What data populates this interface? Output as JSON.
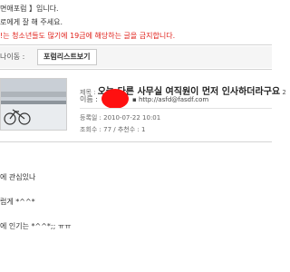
{
  "notice": {
    "line1": "면애포럼 】입니다.",
    "line2": "로에게 잘 해 주세요.",
    "line3": "!는 청소년들도 많기에 19금에 해당하는 글을 금지합니다."
  },
  "nav": {
    "label": "나이동 :",
    "list_button": "포럼리스트보기"
  },
  "post": {
    "title_label": "제목 :",
    "title": "오늘 다른 사무실 여직원이 먼저 인사하더라구요",
    "comment_count": "2",
    "author_label": "이름 :",
    "homepage": "http://asfd@fasdf.com",
    "date": "등록일 : 2010-07-22 10:01",
    "stats": "조회수 : 77 / 추천수 : 1"
  },
  "body_lines": [
    "에 관심있나",
    "럽게    *^^*",
    "에 인기는 *^^*;; ㅠㅠ"
  ]
}
